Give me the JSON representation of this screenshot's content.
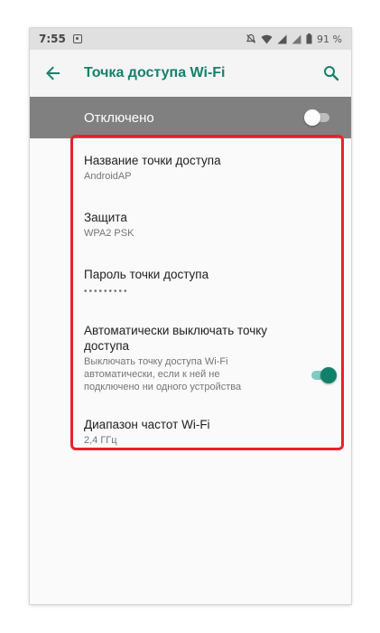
{
  "status_bar": {
    "time": "7:55",
    "battery": "91 %"
  },
  "toolbar": {
    "title": "Точка доступа Wi-Fi",
    "back_icon": "arrow-back-icon",
    "search_icon": "search-icon",
    "accent_color": "#16806b"
  },
  "master_switch": {
    "label": "Отключено",
    "on": false
  },
  "settings": {
    "ap_name": {
      "title": "Название точки доступа",
      "value": "AndroidAP"
    },
    "security": {
      "title": "Защита",
      "value": "WPA2 PSK"
    },
    "password": {
      "title": "Пароль точки доступа",
      "value": "•••••••••"
    },
    "auto_off": {
      "title_line1": "Автоматически выключать точку",
      "title_line2": "доступа",
      "summary_line1": "Выключать точку доступа Wi-Fi",
      "summary_line2": "автоматически, если к ней не",
      "summary_line3": "подключено ни одного устройства",
      "on": true
    },
    "band": {
      "title": "Диапазон частот Wi-Fi",
      "value": "2,4 ГГц"
    }
  },
  "highlight_color": "#e8212e"
}
